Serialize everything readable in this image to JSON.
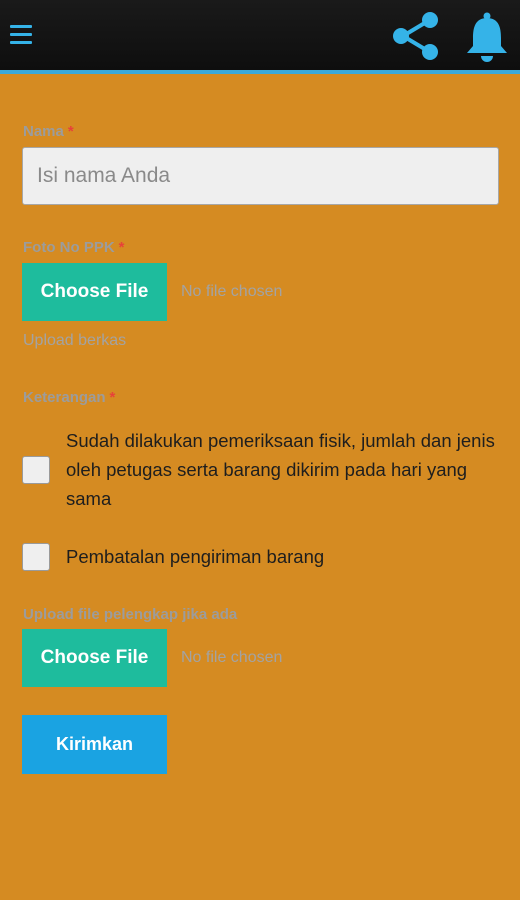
{
  "header": {
    "menu_icon": "hamburger-icon",
    "share_icon": "share-icon",
    "bell_icon": "bell-icon",
    "accent_color": "#35b3e8"
  },
  "form": {
    "name": {
      "label": "Nama",
      "required_mark": "*",
      "placeholder": "Isi nama Anda"
    },
    "foto_ppk": {
      "label": "Foto No PPK",
      "required_mark": "*",
      "button_label": "Choose File",
      "status": "No file chosen",
      "hint": "Upload berkas"
    },
    "keterangan": {
      "label": "Keterangan",
      "required_mark": "*",
      "options": [
        {
          "label": "Sudah dilakukan pemeriksaan fisik, jumlah dan jenis oleh petugas serta barang dikirim pada hari yang sama",
          "checked": false
        },
        {
          "label": "Pembatalan pengiriman barang",
          "checked": false
        }
      ]
    },
    "pelengkap": {
      "label": "Upload file pelengkap jika ada",
      "button_label": "Choose File",
      "status": "No file chosen"
    },
    "submit_label": "Kirimkan"
  },
  "colors": {
    "background": "#d58b22",
    "file_button": "#1ebc9d",
    "submit_button": "#1aa3e2",
    "required": "#e8413a"
  }
}
